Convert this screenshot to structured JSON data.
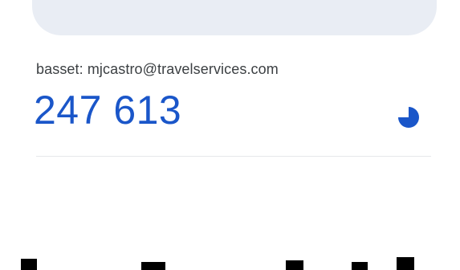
{
  "account": {
    "label": "basset: mjcastro@travelservices.com"
  },
  "otp": {
    "code": "247 613",
    "timer_icon": "countdown-pie-icon",
    "timer_remaining_fraction": 0.75
  },
  "colors": {
    "code": "#1a56c9",
    "timer": "#1a56c9",
    "label": "#3c4043",
    "card": "#e9edf4",
    "divider": "#e6e8eb"
  }
}
